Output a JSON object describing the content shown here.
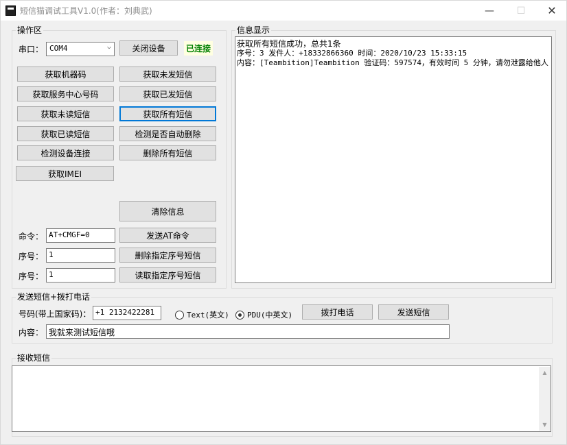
{
  "window": {
    "title": "短信猫调试工具V1.0(作者：刘典武)",
    "minimize_glyph": "—",
    "maximize_glyph": "☐",
    "close_glyph": "✕"
  },
  "operation": {
    "legend": "操作区",
    "port_label": "串口：",
    "port_value": "COM4",
    "close_device_label": "关闭设备",
    "status": "已连接",
    "buttons_left": [
      "获取机器码",
      "获取服务中心号码",
      "获取未读短信",
      "获取已读短信",
      "检测设备连接",
      "获取IMEI"
    ],
    "buttons_right": [
      "获取未发短信",
      "获取已发短信",
      "获取所有短信",
      "检测是否自动删除",
      "删除所有短信"
    ],
    "clear_label": "清除信息",
    "command_label": "命令：",
    "command_value": "AT+CMGF=0",
    "send_at_label": "发送AT命令",
    "index_label": "序号：",
    "delete_index_value": "1",
    "delete_index_button": "删除指定序号短信",
    "read_index_value": "1",
    "read_index_button": "读取指定序号短信"
  },
  "info": {
    "legend": "信息显示",
    "lines": [
      "获取所有短信成功，总共1条",
      "序号：3  发件人：+18332866360  时间：2020/10/23 15:33:15",
      "内容：[Teambition]Teambition 验证码：597574，有效时间 5 分钟，请勿泄露给他人"
    ]
  },
  "send": {
    "legend": "发送短信+拨打电话",
    "number_label": "号码(带上国家码)：",
    "number_value": "+1 2132422281",
    "text_radio_label": "Text(英文)",
    "pdu_radio_label": "PDU(中英文)",
    "selected_mode": "PDU",
    "call_label": "拨打电话",
    "send_label": "发送短信",
    "content_label": "内容：",
    "content_value": "我就来测试短信哦"
  },
  "receive": {
    "legend": "接收短信",
    "scroll_up_glyph": "▲",
    "scroll_down_glyph": "▼"
  }
}
